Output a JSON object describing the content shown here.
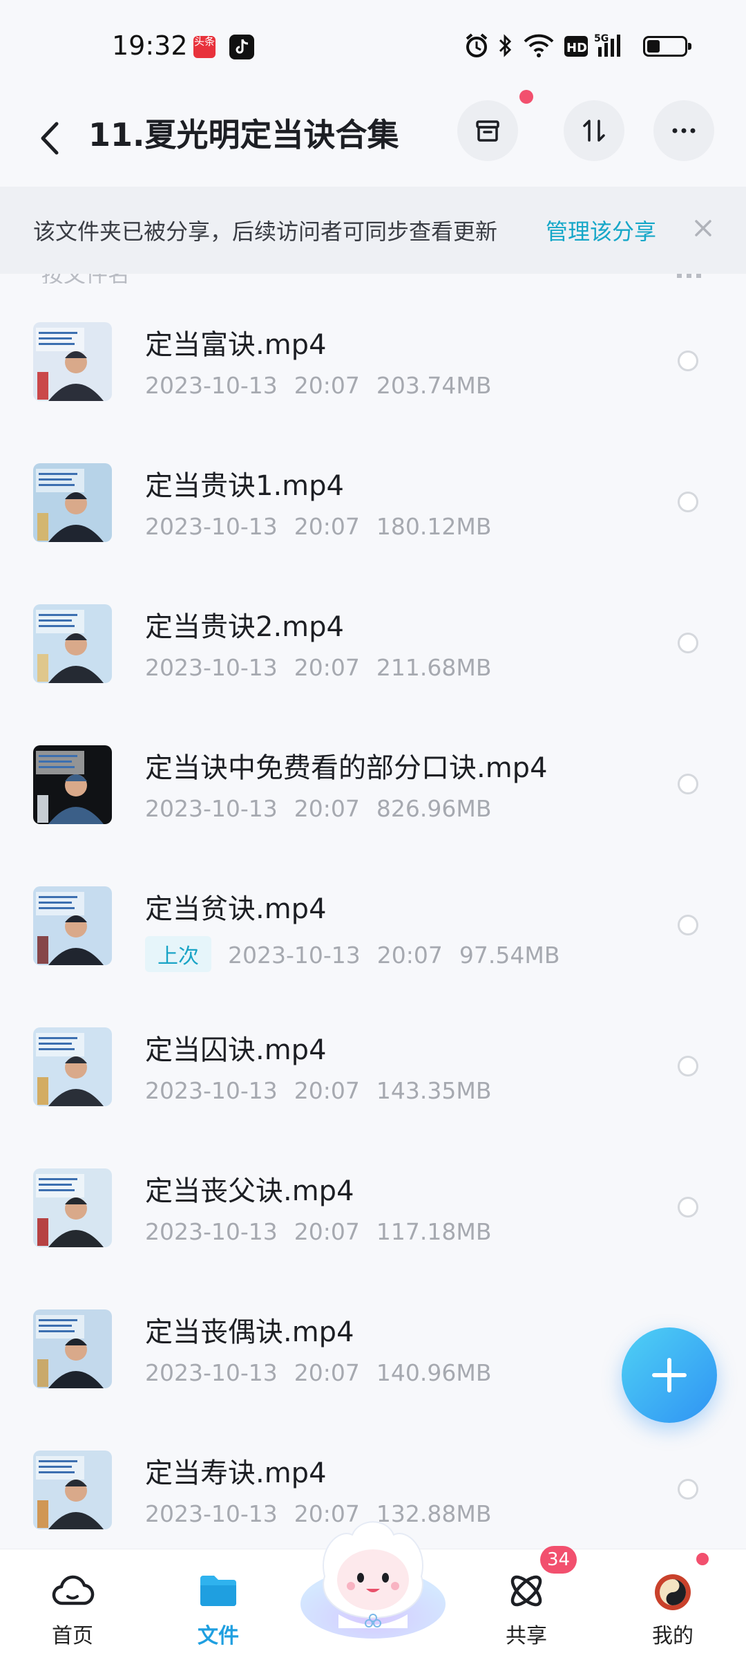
{
  "status_bar": {
    "time": "19:32",
    "app_icon_1": "头条",
    "app_icon_2": "tiktok-icon",
    "hd_label": "HD",
    "network": "5G",
    "battery_level": 0.35
  },
  "header": {
    "title": "11.夏光明定当诀合集",
    "back_icon": "chevron-left-icon",
    "actions": [
      "archive-icon",
      "sort-icon",
      "more-icon"
    ]
  },
  "share_banner": {
    "text": "该文件夹已被分享，后续访问者可同步查看更新",
    "link": "管理该分享"
  },
  "sort_row": {
    "label": "按文件名"
  },
  "files": [
    {
      "name": "定当富诀.mp4",
      "date": "2023-10-13",
      "time": "20:07",
      "size": "203.74MB",
      "badge": ""
    },
    {
      "name": "定当贵诀1.mp4",
      "date": "2023-10-13",
      "time": "20:07",
      "size": "180.12MB",
      "badge": ""
    },
    {
      "name": "定当贵诀2.mp4",
      "date": "2023-10-13",
      "time": "20:07",
      "size": "211.68MB",
      "badge": ""
    },
    {
      "name": "定当诀中免费看的部分口诀.mp4",
      "date": "2023-10-13",
      "time": "20:07",
      "size": "826.96MB",
      "badge": ""
    },
    {
      "name": "定当贫诀.mp4",
      "date": "2023-10-13",
      "time": "20:07",
      "size": "97.54MB",
      "badge": "上次"
    },
    {
      "name": "定当囚诀.mp4",
      "date": "2023-10-13",
      "time": "20:07",
      "size": "143.35MB",
      "badge": ""
    },
    {
      "name": "定当丧父诀.mp4",
      "date": "2023-10-13",
      "time": "20:07",
      "size": "117.18MB",
      "badge": ""
    },
    {
      "name": "定当丧偶诀.mp4",
      "date": "2023-10-13",
      "time": "20:07",
      "size": "140.96MB",
      "badge": ""
    },
    {
      "name": "定当寿诀.mp4",
      "date": "2023-10-13",
      "time": "20:07",
      "size": "132.88MB",
      "badge": ""
    }
  ],
  "fab": {
    "icon": "plus-icon"
  },
  "bottom_nav": {
    "items": [
      {
        "label": "首页",
        "icon": "cloud-icon"
      },
      {
        "label": "文件",
        "icon": "folder-icon"
      },
      {
        "label": "",
        "icon": "mascot-icon"
      },
      {
        "label": "共享",
        "icon": "orbit-icon"
      },
      {
        "label": "我的",
        "icon": "avatar-icon"
      }
    ],
    "share_badge": "34"
  },
  "colors": {
    "accent": "#1f9fe0",
    "link": "#16a7c8",
    "badge_red": "#f2506e"
  }
}
